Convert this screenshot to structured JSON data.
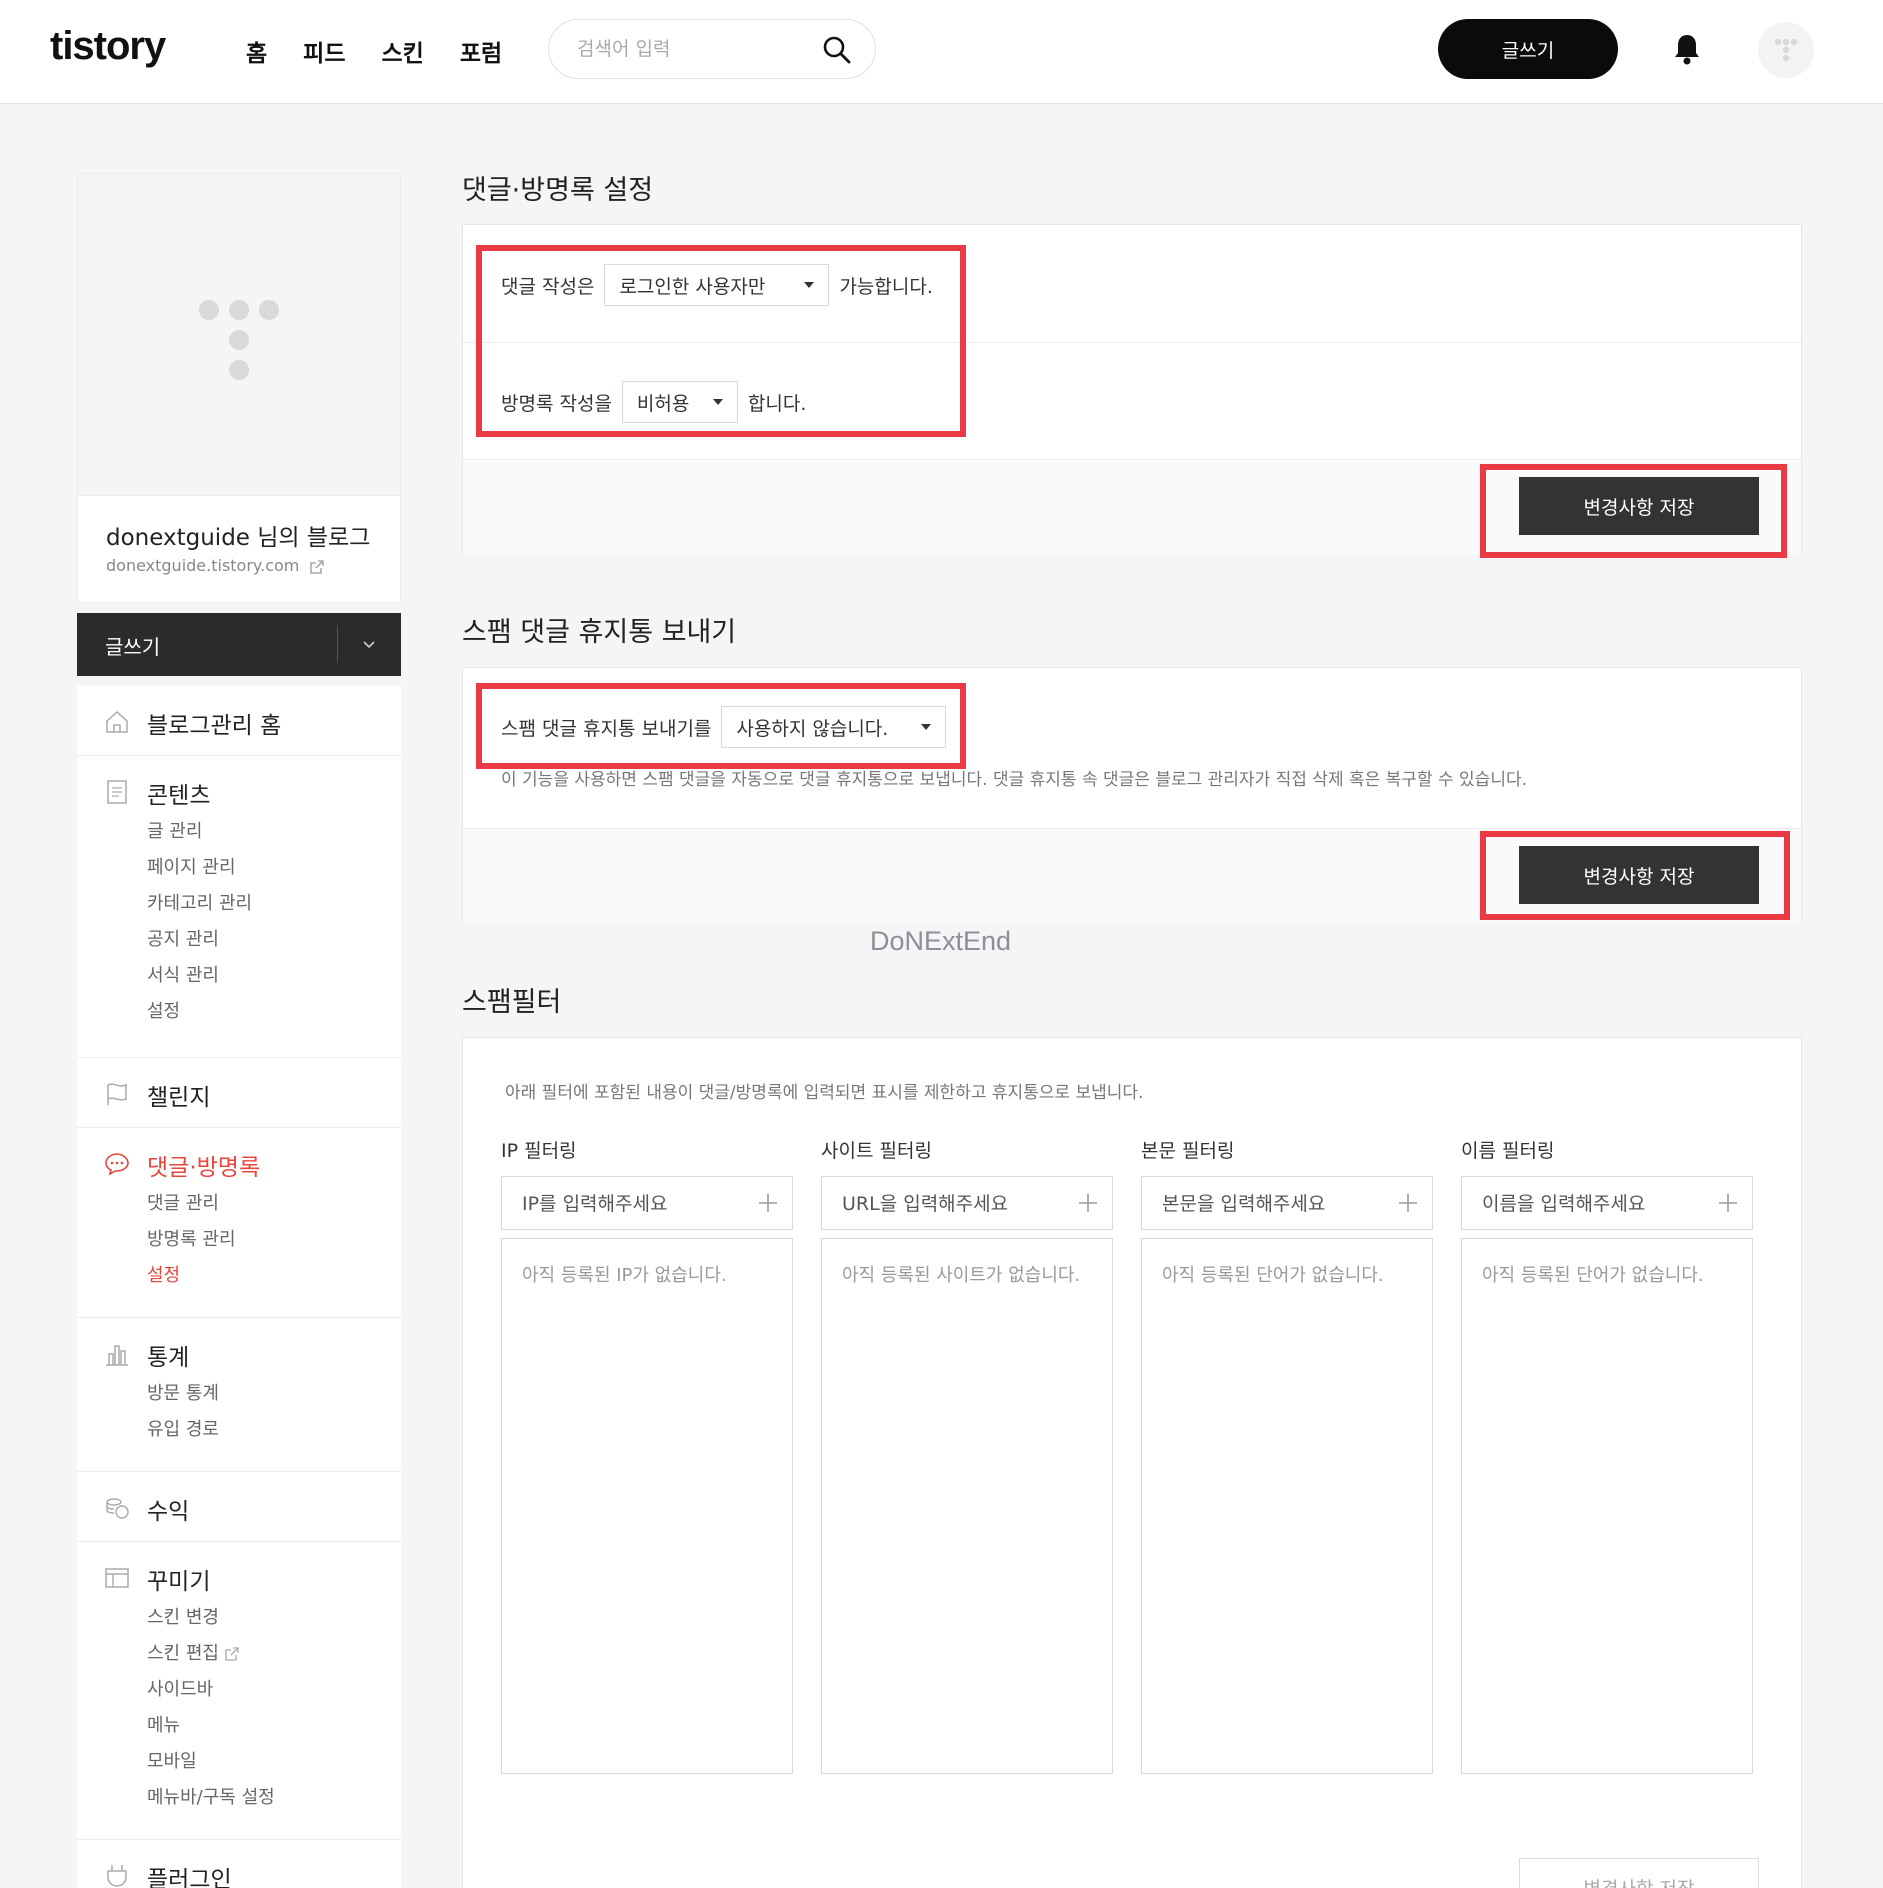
{
  "header": {
    "logo": "tistory",
    "nav": [
      "홈",
      "피드",
      "스킨",
      "포럼"
    ],
    "search_placeholder": "검색어 입력",
    "write_label": "글쓰기"
  },
  "sidebar": {
    "blog_name": "donextguide 님의 블로그",
    "blog_url": "donextguide.tistory.com",
    "write_label": "글쓰기",
    "groups": [
      {
        "label": "블로그관리 홈",
        "icon": "home-icon",
        "items": []
      },
      {
        "label": "콘텐츠",
        "icon": "document-icon",
        "items": [
          "글 관리",
          "페이지 관리",
          "카테고리 관리",
          "공지 관리",
          "서식 관리",
          "설정"
        ]
      },
      {
        "label": "챌린지",
        "icon": "flag-icon",
        "items": []
      },
      {
        "label": "댓글·방명록",
        "icon": "comment-icon",
        "active": true,
        "items": [
          "댓글 관리",
          "방명록 관리",
          "설정"
        ],
        "active_item": "설정"
      },
      {
        "label": "통계",
        "icon": "chart-icon",
        "items": [
          "방문 통계",
          "유입 경로"
        ]
      },
      {
        "label": "수익",
        "icon": "coins-icon",
        "items": []
      },
      {
        "label": "꾸미기",
        "icon": "layout-icon",
        "items": [
          "스킨 변경",
          "스킨 편집",
          "사이드바",
          "메뉴",
          "모바일",
          "메뉴바/구독 설정"
        ]
      },
      {
        "label": "플러그인",
        "icon": "plugin-icon",
        "items": []
      }
    ]
  },
  "comment_settings": {
    "title": "댓글·방명록 설정",
    "comment_prefix": "댓글 작성은",
    "comment_value": "로그인한 사용자만",
    "comment_suffix": "가능합니다.",
    "guest_prefix": "방명록 작성을",
    "guest_value": "비허용",
    "guest_suffix": "합니다.",
    "save_label": "변경사항 저장"
  },
  "spam_trash": {
    "title": "스팸 댓글 휴지통 보내기",
    "prefix": "스팸 댓글 휴지통 보내기를",
    "value": "사용하지 않습니다.",
    "description": "이 기능을 사용하면 스팸 댓글을 자동으로 댓글 휴지통으로 보냅니다. 댓글 휴지통 속 댓글은 블로그 관리자가 직접 삭제 혹은 복구할 수 있습니다.",
    "save_label": "변경사항 저장"
  },
  "watermark": "DoNExtEnd",
  "spam_filter": {
    "title": "스팸필터",
    "description": "아래 필터에 포함된 내용이 댓글/방명록에 입력되면 표시를 제한하고 휴지통으로 보냅니다.",
    "filters": [
      {
        "label": "IP 필터링",
        "placeholder": "IP를 입력해주세요",
        "empty": "아직 등록된 IP가 없습니다."
      },
      {
        "label": "사이트 필터링",
        "placeholder": "URL을 입력해주세요",
        "empty": "아직 등록된 사이트가 없습니다."
      },
      {
        "label": "본문 필터링",
        "placeholder": "본문을 입력해주세요",
        "empty": "아직 등록된 단어가 없습니다."
      },
      {
        "label": "이름 필터링",
        "placeholder": "이름을 입력해주세요",
        "empty": "아직 등록된 단어가 없습니다."
      }
    ],
    "save_label": "변경사항 저장"
  },
  "colors": {
    "accent": "#e8453c",
    "highlight": "#ea3a43",
    "dark_button": "#333333"
  }
}
